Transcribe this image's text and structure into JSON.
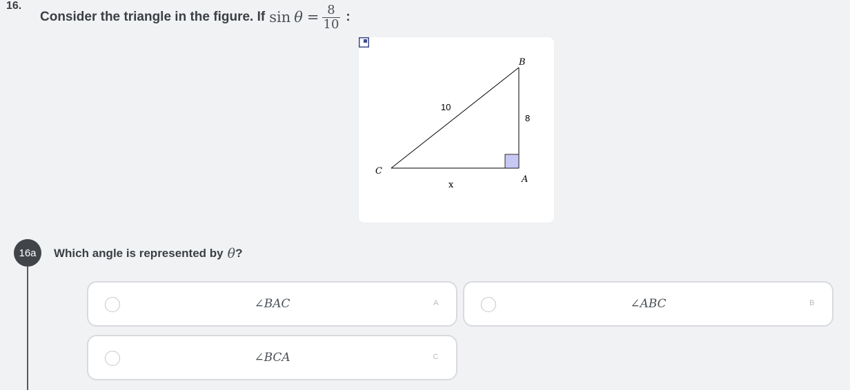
{
  "question": {
    "number": "16.",
    "stem_text": "Consider the triangle in the figure. If",
    "stem_math_fn": "sin",
    "stem_math_var": "θ",
    "stem_math_eq": "=",
    "fraction_numerator": "8",
    "fraction_denominator": "10",
    "stem_suffix": ":"
  },
  "figure": {
    "vertex_b": "B",
    "vertex_a": "A",
    "vertex_c": "C",
    "hypotenuse_label": "10",
    "vertical_leg_label": "8",
    "horizontal_leg_label": "x",
    "right_angle_fill": "#c8c8f5",
    "expand_icon": "expand-image-icon"
  },
  "part": {
    "badge": "16a",
    "prompt_text": "Which angle is represented by",
    "prompt_math": "θ",
    "prompt_suffix": "?",
    "badge_color": "#414449"
  },
  "options": [
    {
      "text": "∠BAC",
      "letter": "A"
    },
    {
      "text": "∠ABC",
      "letter": "B"
    },
    {
      "text": "∠BCA",
      "letter": "C"
    }
  ]
}
